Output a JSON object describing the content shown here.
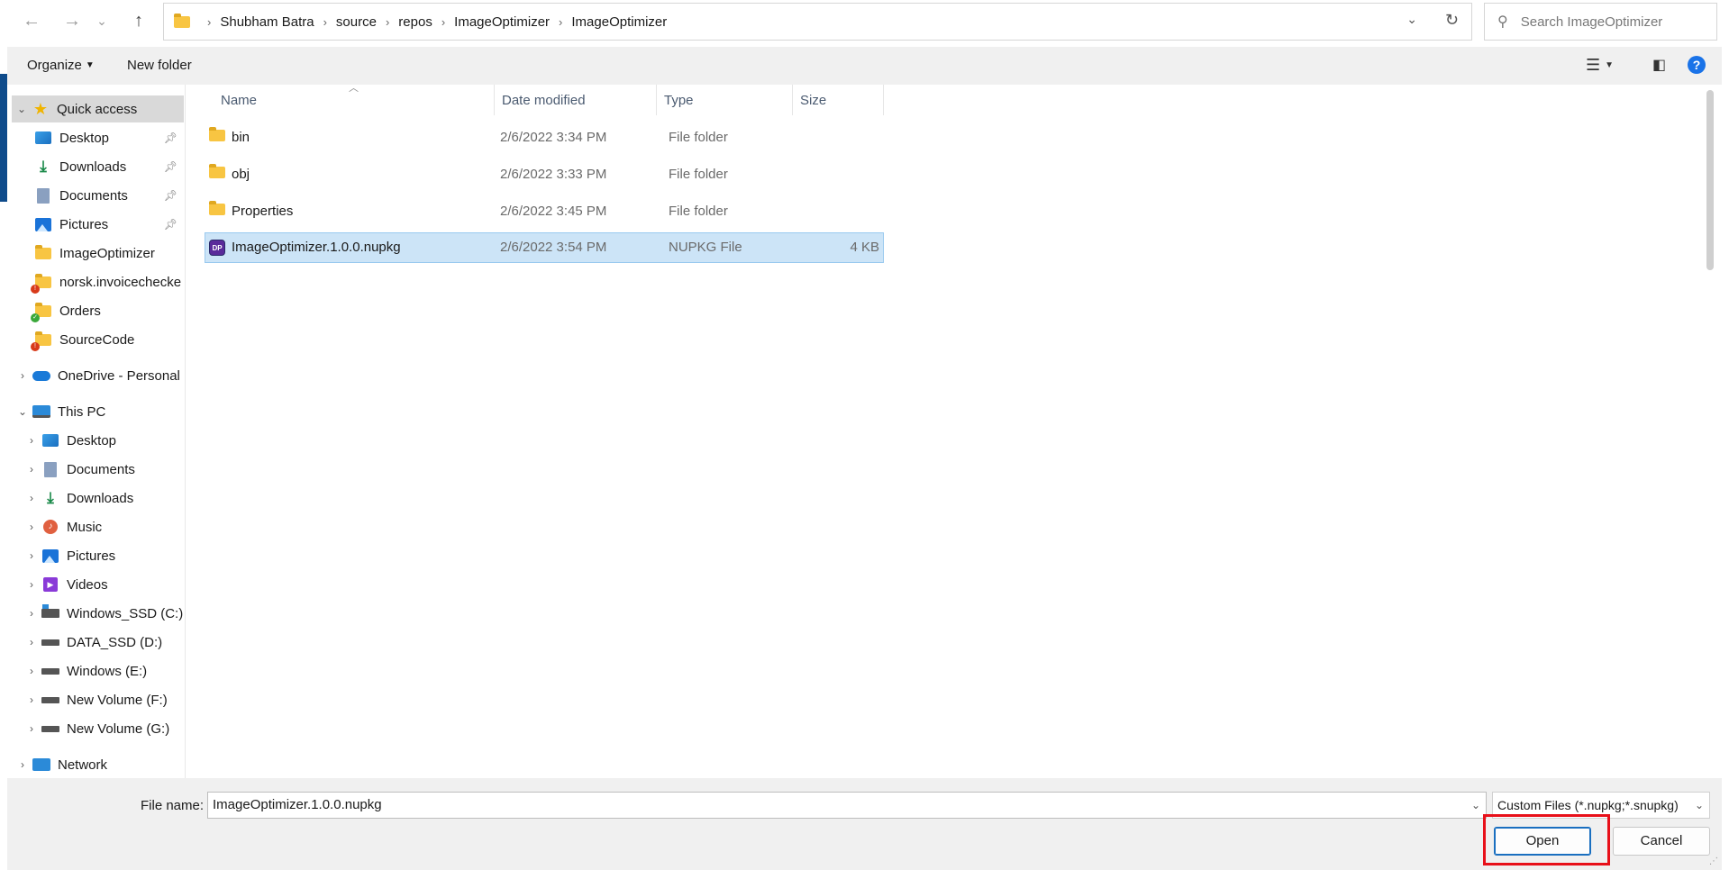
{
  "nav_buttons": {
    "back": "←",
    "forward": "→",
    "recent": "⌄",
    "up": "↑"
  },
  "breadcrumb": [
    "Shubham Batra",
    "source",
    "repos",
    "ImageOptimizer",
    "ImageOptimizer"
  ],
  "search": {
    "placeholder": "Search ImageOptimizer"
  },
  "toolbar": {
    "organize": "Organize",
    "new_folder": "New folder"
  },
  "sidebar": {
    "quick_access": "Quick access",
    "quick_items": [
      {
        "label": "Desktop",
        "icon": "desktop-icon",
        "pinned": true
      },
      {
        "label": "Downloads",
        "icon": "downloads-icon",
        "pinned": true
      },
      {
        "label": "Documents",
        "icon": "documents-icon",
        "pinned": true
      },
      {
        "label": "Pictures",
        "icon": "pictures-icon",
        "pinned": true
      },
      {
        "label": "ImageOptimizer",
        "icon": "folder-icon",
        "pinned": false
      },
      {
        "label": "norsk.invoicechecke",
        "icon": "folder-icon",
        "pinned": false
      },
      {
        "label": "Orders",
        "icon": "folder-icon",
        "pinned": false
      },
      {
        "label": "SourceCode",
        "icon": "folder-icon",
        "pinned": false
      }
    ],
    "onedrive": "OneDrive - Personal",
    "this_pc": "This PC",
    "pc_items": [
      {
        "label": "Desktop",
        "icon": "desktop-icon"
      },
      {
        "label": "Documents",
        "icon": "documents-icon"
      },
      {
        "label": "Downloads",
        "icon": "downloads-icon"
      },
      {
        "label": "Music",
        "icon": "music-icon"
      },
      {
        "label": "Pictures",
        "icon": "pictures-icon"
      },
      {
        "label": "Videos",
        "icon": "videos-icon"
      },
      {
        "label": "Windows_SSD (C:)",
        "icon": "drive-icon"
      },
      {
        "label": "DATA_SSD (D:)",
        "icon": "drive-icon"
      },
      {
        "label": "Windows (E:)",
        "icon": "drive-icon"
      },
      {
        "label": "New Volume (F:)",
        "icon": "drive-icon"
      },
      {
        "label": "New Volume (G:)",
        "icon": "drive-icon"
      }
    ],
    "network": "Network"
  },
  "columns": {
    "name": "Name",
    "date": "Date modified",
    "type": "Type",
    "size": "Size"
  },
  "files": [
    {
      "name": "bin",
      "date": "2/6/2022 3:34 PM",
      "type": "File folder",
      "size": "",
      "icon": "folder-icon"
    },
    {
      "name": "obj",
      "date": "2/6/2022 3:33 PM",
      "type": "File folder",
      "size": "",
      "icon": "folder-icon"
    },
    {
      "name": "Properties",
      "date": "2/6/2022 3:45 PM",
      "type": "File folder",
      "size": "",
      "icon": "folder-icon"
    },
    {
      "name": "ImageOptimizer.1.0.0.nupkg",
      "date": "2/6/2022 3:54 PM",
      "type": "NUPKG File",
      "size": "4 KB",
      "icon": "nupkg-file-icon",
      "selected": true
    }
  ],
  "footer": {
    "file_name_label": "File name:",
    "file_name_value": "ImageOptimizer.1.0.0.nupkg",
    "filter_value": "Custom Files (*.nupkg;*.snupkg)",
    "open_label": "Open",
    "cancel_label": "Cancel"
  },
  "colors": {
    "selection": "#cce4f7",
    "highlight_box": "#e8101a",
    "accent": "#0e4b8b"
  }
}
